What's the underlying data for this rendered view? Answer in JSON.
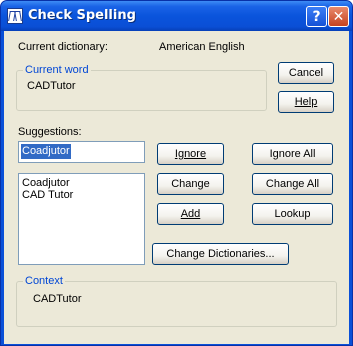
{
  "window": {
    "title": "Check Spelling"
  },
  "title_buttons": {
    "help": "?",
    "close": "✕"
  },
  "dictionary": {
    "label": "Current dictionary:",
    "value": "American English"
  },
  "current_word": {
    "legend": "Current word",
    "value": "CADTutor"
  },
  "suggestions": {
    "label": "Suggestions:",
    "input_value": "Coadjutor",
    "items": [
      "Coadjutor",
      "CAD Tutor"
    ]
  },
  "buttons": {
    "cancel": "Cancel",
    "help": "Help",
    "ignore": "Ignore",
    "ignore_all": "Ignore All",
    "change": "Change",
    "change_all": "Change All",
    "add": "Add",
    "lookup": "Lookup",
    "change_dictionaries": "Change Dictionaries..."
  },
  "context": {
    "legend": "Context",
    "value": "CADTutor"
  },
  "colors": {
    "title_bar": "#0a54dc",
    "client": "#ece9d8",
    "group_label": "#0046d5",
    "selection": "#316ac5"
  }
}
